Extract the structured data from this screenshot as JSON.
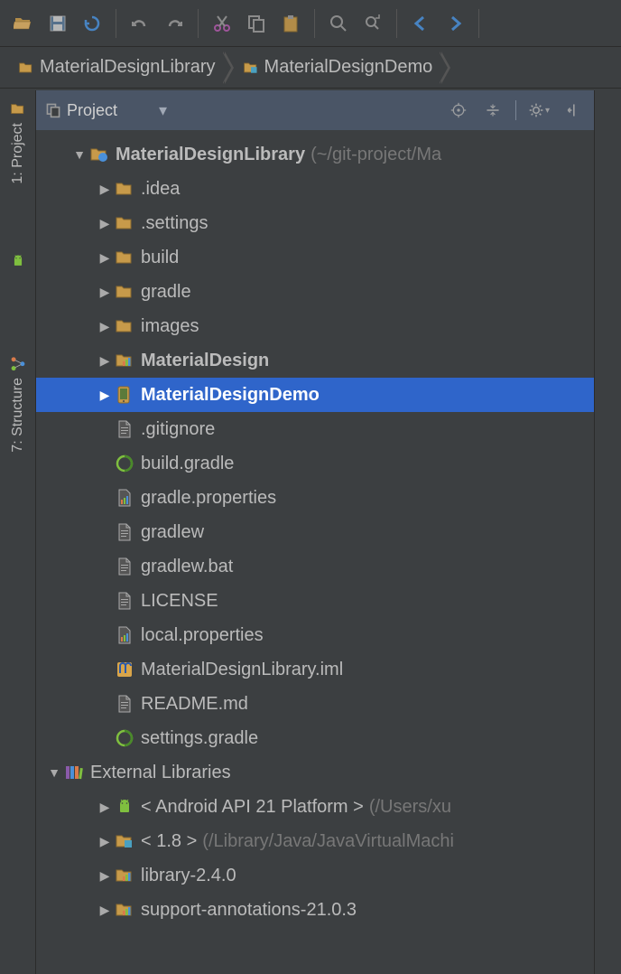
{
  "toolbar": {
    "buttons": [
      "open",
      "save",
      "sync",
      "undo",
      "redo",
      "cut",
      "copy",
      "paste",
      "find",
      "replace",
      "back",
      "forward"
    ]
  },
  "breadcrumb": {
    "items": [
      {
        "label": "MaterialDesignLibrary",
        "icon": "folder"
      },
      {
        "label": "MaterialDesignDemo",
        "icon": "module"
      }
    ]
  },
  "gutter": {
    "tabs": [
      {
        "label": "1: Project"
      },
      {
        "label": "7: Structure"
      }
    ]
  },
  "panel": {
    "title": "Project",
    "dropdown_icon": "chevron-down"
  },
  "tree": {
    "root": {
      "label": "MaterialDesignLibrary",
      "path": "(~/git-project/Ma",
      "expanded": true,
      "icon": "project-folder",
      "children": [
        {
          "label": ".idea",
          "icon": "folder",
          "arrow": true
        },
        {
          "label": ".settings",
          "icon": "folder",
          "arrow": true
        },
        {
          "label": "build",
          "icon": "folder",
          "arrow": true
        },
        {
          "label": "gradle",
          "icon": "folder",
          "arrow": true
        },
        {
          "label": "images",
          "icon": "folder",
          "arrow": true
        },
        {
          "label": "MaterialDesign",
          "icon": "module-bars",
          "arrow": true,
          "bold": true
        },
        {
          "label": "MaterialDesignDemo",
          "icon": "module-phone",
          "arrow": true,
          "selected": true,
          "bold": true
        },
        {
          "label": ".gitignore",
          "icon": "file"
        },
        {
          "label": "build.gradle",
          "icon": "gradle"
        },
        {
          "label": "gradle.properties",
          "icon": "properties-bars"
        },
        {
          "label": "gradlew",
          "icon": "file"
        },
        {
          "label": "gradlew.bat",
          "icon": "file"
        },
        {
          "label": "LICENSE",
          "icon": "file"
        },
        {
          "label": "local.properties",
          "icon": "properties-bars"
        },
        {
          "label": "MaterialDesignLibrary.iml",
          "icon": "iml"
        },
        {
          "label": "README.md",
          "icon": "file"
        },
        {
          "label": "settings.gradle",
          "icon": "gradle"
        }
      ]
    },
    "external": {
      "label": "External Libraries",
      "icon": "libraries",
      "expanded": true,
      "children": [
        {
          "label": "< Android API 21 Platform >",
          "extra": "(/Users/xu",
          "icon": "android",
          "arrow": true
        },
        {
          "label": "< 1.8 >",
          "extra": "(/Library/Java/JavaVirtualMachi",
          "icon": "jdk-folder",
          "arrow": true
        },
        {
          "label": "library-2.4.0",
          "icon": "lib-bars",
          "arrow": true
        },
        {
          "label": "support-annotations-21.0.3",
          "icon": "lib-bars",
          "arrow": true
        }
      ]
    }
  }
}
